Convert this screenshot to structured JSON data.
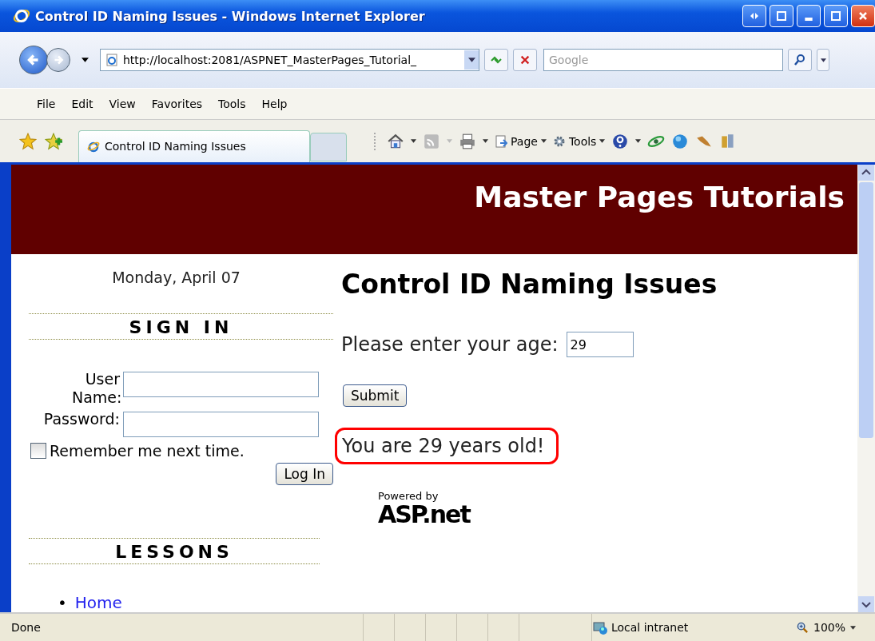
{
  "window": {
    "title": "Control ID Naming Issues - Windows Internet Explorer"
  },
  "nav": {
    "address": "http://localhost:2081/ASPNET_MasterPages_Tutorial_",
    "search_placeholder": "Google"
  },
  "menu": [
    "File",
    "Edit",
    "View",
    "Favorites",
    "Tools",
    "Help"
  ],
  "tabs": [
    {
      "label": "Control ID Naming Issues",
      "selected": true
    }
  ],
  "commands": [
    {
      "label": "Page"
    },
    {
      "label": "Tools"
    }
  ],
  "page": {
    "banner_title": "Master Pages Tutorials",
    "date": "Monday, April 07",
    "sign_in": {
      "heading": "SIGN IN",
      "username_label": "User Name:",
      "password_label": "Password:",
      "remember": {
        "label": "Remember me next time.",
        "checked": false
      },
      "button": "Log In"
    },
    "lessons": {
      "heading": "LESSONS",
      "links": [
        {
          "bullet": "•",
          "label": "Home"
        }
      ]
    },
    "main": {
      "heading": "Control ID Naming Issues",
      "age_label": "Please enter your age:",
      "age_value": "29",
      "submit": "Submit",
      "result": "You are 29 years old!",
      "powered_by": "Powered by",
      "logo": "ASP.net"
    }
  },
  "status": {
    "text": "Done",
    "zone": "Local intranet",
    "zoom": "100%"
  }
}
